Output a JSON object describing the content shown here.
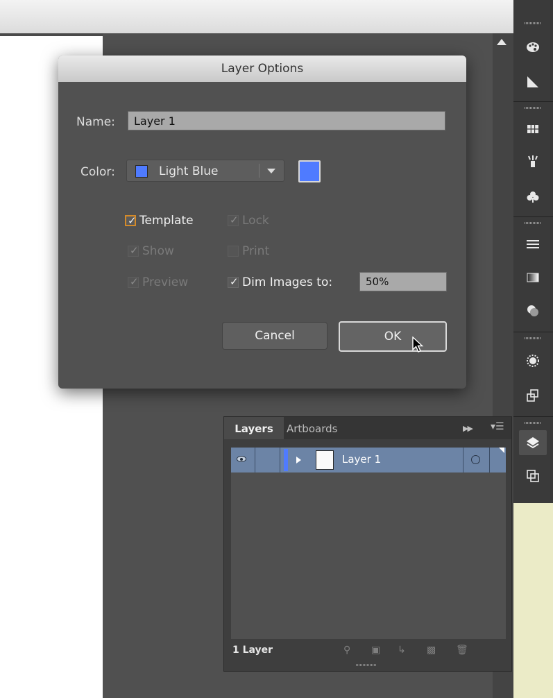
{
  "dialog": {
    "title": "Layer Options",
    "name_label": "Name:",
    "name_value": "Layer 1",
    "color_label": "Color:",
    "color_value": "Light Blue",
    "color_hex": "#4f7bff",
    "checkboxes": {
      "template": {
        "label": "Template",
        "checked": true
      },
      "lock": {
        "label": "Lock",
        "checked": true
      },
      "show": {
        "label": "Show",
        "checked": true
      },
      "print": {
        "label": "Print",
        "checked": false
      },
      "preview": {
        "label": "Preview",
        "checked": true
      },
      "dim_images": {
        "label": "Dim Images to:",
        "checked": true
      }
    },
    "dim_value": "50%",
    "cancel_label": "Cancel",
    "ok_label": "OK"
  },
  "layers_panel": {
    "tabs": [
      "Layers",
      "Artboards"
    ],
    "layer": {
      "name": "Layer 1"
    },
    "count_label": "1 Layer"
  },
  "toolbar": {
    "icons": [
      "color-guide-icon",
      "gradient-triangle-icon",
      "swatches-grid-icon",
      "brushes-icon",
      "symbols-club-icon",
      "stroke-lines-icon",
      "gradient-icon",
      "transparency-icon",
      "appearance-icon",
      "transform-icon",
      "layers-icon",
      "artboards-icon"
    ]
  }
}
